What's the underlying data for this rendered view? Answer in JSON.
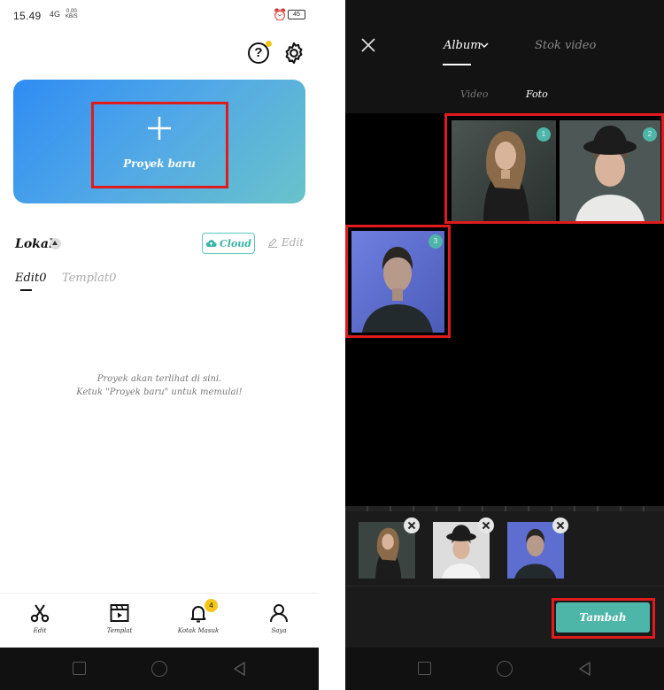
{
  "left": {
    "status": {
      "time": "15.49",
      "signal": "4G",
      "net_top": "0,00",
      "net_bottom": "KB/S",
      "battery": "45"
    },
    "new_project": {
      "label": "Proyek baru"
    },
    "section": {
      "title": "Lokal",
      "cloud_label": "Cloud",
      "edit_label": "Edit"
    },
    "tabs": [
      {
        "label": "Edit0"
      },
      {
        "label": "Templat0"
      }
    ],
    "empty": {
      "line1": "Proyek akan terlihat di sini.",
      "line2": "Ketuk \"Proyek baru\" untuk memulai!"
    },
    "nav": [
      {
        "label": "Edit",
        "icon": "scissors-icon"
      },
      {
        "label": "Templat",
        "icon": "clapper-icon"
      },
      {
        "label": "Kotak Masuk",
        "icon": "bell-icon",
        "badge": "4"
      },
      {
        "label": "Saya",
        "icon": "person-icon"
      }
    ]
  },
  "right": {
    "tabs": [
      {
        "label": "Album"
      },
      {
        "label": "Stok video"
      }
    ],
    "subtabs": [
      {
        "label": "Video"
      },
      {
        "label": "Foto"
      }
    ],
    "photos": [
      {
        "badge": "1"
      },
      {
        "badge": "2"
      },
      {
        "badge": "3"
      }
    ],
    "add_button": {
      "label": "Tambah"
    }
  },
  "colors": {
    "accent": "#4db6a8",
    "highlight": "#e01b1b",
    "card_start": "#2f8cf3",
    "card_end": "#69c3c9",
    "badge_yellow": "#f5c518"
  }
}
